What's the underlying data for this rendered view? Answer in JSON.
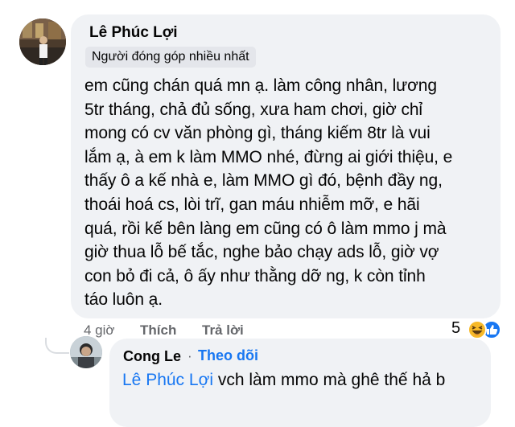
{
  "comment": {
    "author": "Lê Phúc Lợi",
    "badge": "Người đóng góp nhiều nhất",
    "lines": [
      "em cũng chán quá mn ạ. làm công nhân, lương",
      "5tr tháng, chả đủ sống, xưa ham chơi, giờ chỉ",
      "mong có cv văn phòng gì, tháng kiếm 8tr là vui",
      "lắm ạ, à em k làm MMO nhé, đừng ai giới thiệu, e",
      "thấy ô a kế nhà e, làm MMO gì đó, bệnh đầy ng,",
      "thoái hoá cs, lòi trĩ, gan máu nhiễm mỡ, e hãi",
      "quá, rồi kế bên làng em cũng có ô làm mmo j mà",
      "giờ thua lỗ bế tắc, nghe bảo chạy ads lỗ, giờ vợ",
      "con bỏ đi cả, ô ấy như thằng dỡ ng, k còn tỉnh",
      "táo luôn ạ."
    ],
    "time": "4 giờ",
    "like_label": "Thích",
    "reply_label": "Trả lời",
    "reaction_count": "5",
    "reaction_icons": [
      "haha-emoji-icon",
      "like-thumb-icon"
    ]
  },
  "reply": {
    "author": "Cong Le",
    "separator": "·",
    "follow_label": "Theo dõi",
    "mention": "Lê Phúc Lợi",
    "text": " vch làm mmo mà ghê thế hả b"
  },
  "colors": {
    "bubble_bg": "#f0f2f5",
    "link_blue": "#1877f2",
    "meta_gray": "#65676b",
    "like_blue": "#1877f2",
    "haha_yellow": "#f7b928"
  }
}
